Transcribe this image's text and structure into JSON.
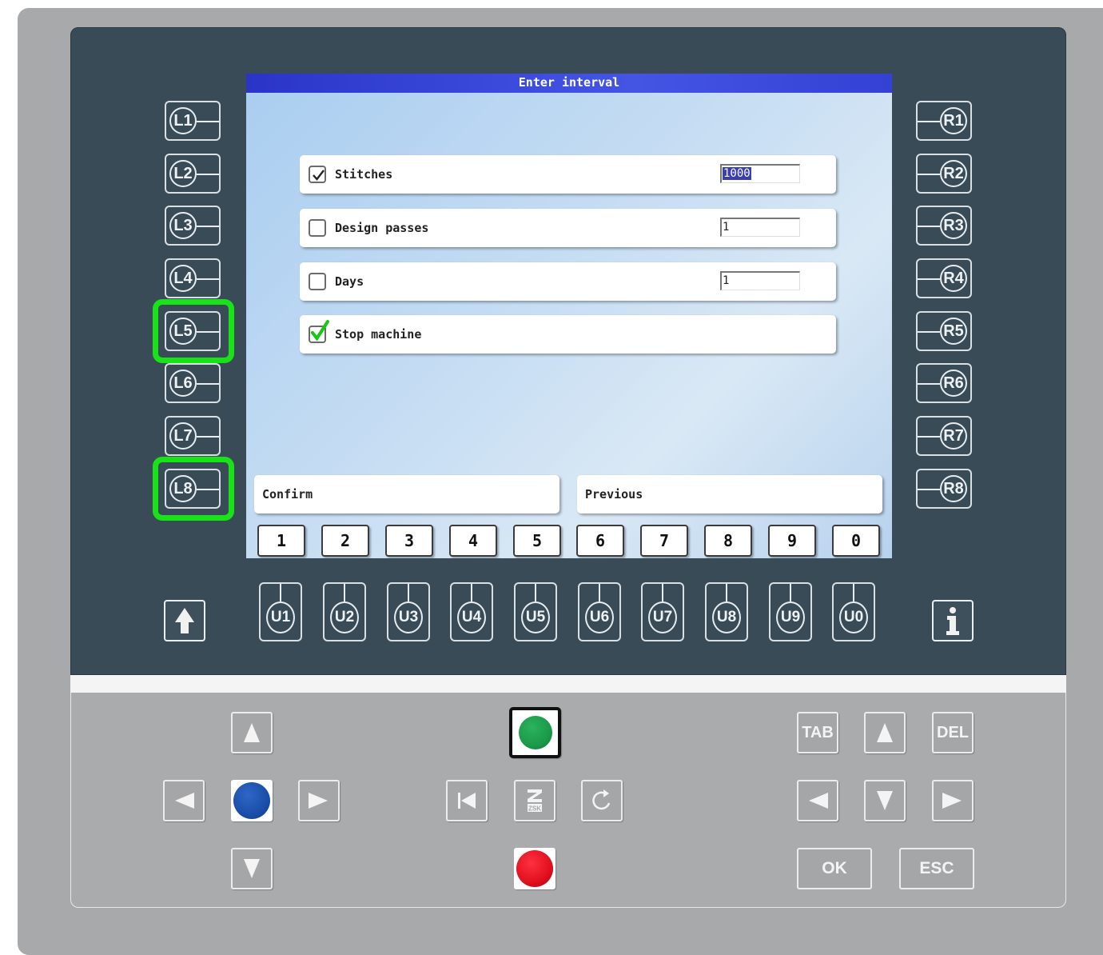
{
  "dialog": {
    "title": "Enter interval",
    "rows": [
      {
        "label": "Stitches",
        "checked": true,
        "value": "1000",
        "selected": true
      },
      {
        "label": "Design passes",
        "checked": false,
        "value": "1",
        "selected": false
      },
      {
        "label": "Days",
        "checked": false,
        "value": "1",
        "selected": false
      },
      {
        "label": "Stop machine",
        "checked": true,
        "highlight_check": true
      }
    ],
    "confirm_label": "Confirm",
    "previous_label": "Previous",
    "numbers": [
      "1",
      "2",
      "3",
      "4",
      "5",
      "6",
      "7",
      "8",
      "9",
      "0"
    ]
  },
  "left_keys": [
    "L1",
    "L2",
    "L3",
    "L4",
    "L5",
    "L6",
    "L7",
    "L8"
  ],
  "right_keys": [
    "R1",
    "R2",
    "R3",
    "R4",
    "R5",
    "R6",
    "R7",
    "R8"
  ],
  "u_keys": [
    "U1",
    "U2",
    "U3",
    "U4",
    "U5",
    "U6",
    "U7",
    "U8",
    "U9",
    "U0"
  ],
  "highlighted_keys": [
    "L5",
    "L8"
  ],
  "control_panel": {
    "tab_label": "TAB",
    "del_label": "DEL",
    "ok_label": "OK",
    "esc_label": "ESC",
    "logo_text": "ZSK"
  },
  "colors": {
    "highlight": "#19e219",
    "title_bar": "#3441d4",
    "start": "#1a9a4a",
    "stop": "#e0101e",
    "joystick": "#1a4ea8"
  }
}
